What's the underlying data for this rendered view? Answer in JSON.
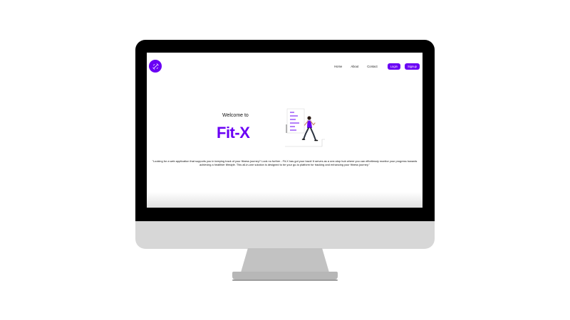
{
  "app": {
    "brand": "Fit-X",
    "welcome": "Welcome to",
    "description": "\"Looking for a web application that supports you in keeping track of your fitness journey? Look no further - Fit-X has got your back! It serves as a one-stop hub where you can effortlessly monitor your progress towards achieving a healthier lifestyle. This all-in-one solution is designed to be your go-to platform for tracking and enhancing your fitness journey.\""
  },
  "nav": {
    "items": [
      {
        "label": "Home"
      },
      {
        "label": "About"
      },
      {
        "label": "Contact"
      }
    ],
    "login_label": "Login",
    "signup_label": "Signup"
  },
  "colors": {
    "accent": "#6a00f4",
    "bezel": "#000000",
    "chin": "#d7d7d7",
    "stand": "#c2c2c2"
  },
  "icons": {
    "logo": "dumbbell-logo-icon",
    "illustration": "running-man-checklist-illustration"
  }
}
